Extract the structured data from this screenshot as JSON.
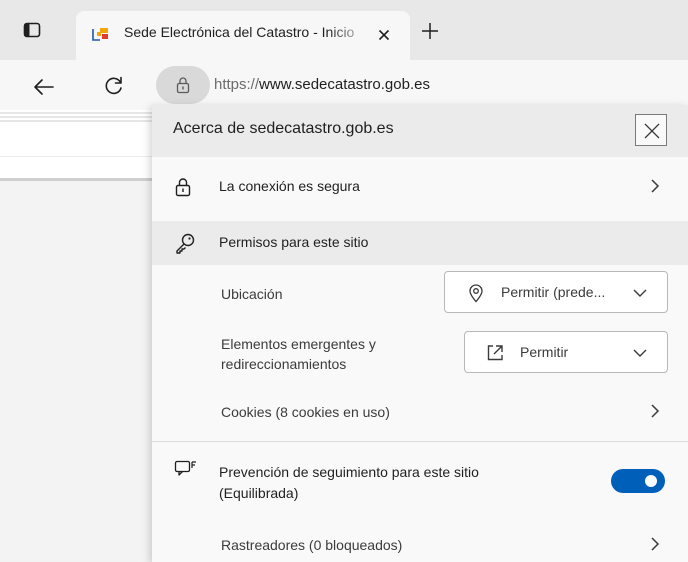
{
  "browser": {
    "tab": {
      "title": "Sede Electrónica del Catastro - Inicio"
    },
    "address": {
      "scheme": "https://",
      "host": "www.sedecatastro.gob.es"
    }
  },
  "flyout": {
    "title": "Acerca de sedecatastro.gob.es",
    "connection": {
      "label": "La conexión es segura"
    },
    "permissions": {
      "header": "Permisos para este sitio",
      "location": {
        "label": "Ubicación",
        "value": "Permitir (prede..."
      },
      "popups": {
        "label": "Elementos emergentes y redireccionamientos",
        "value": "Permitir"
      },
      "cookies": {
        "label": "Cookies (8 cookies en uso)"
      }
    },
    "tracking": {
      "label": "Prevención de seguimiento para este sitio (Equilibrada)",
      "enabled": true
    },
    "trackers": {
      "label": "Rastreadores (0 bloqueados)"
    }
  },
  "icons": {
    "tab_actions": "tab-actions-icon",
    "favicon": "catastro-favicon-icon",
    "close": "close-icon",
    "new_tab": "plus-icon",
    "back": "back-arrow-icon",
    "refresh": "refresh-icon",
    "lock": "lock-icon",
    "key": "key-icon",
    "location": "location-pin-icon",
    "external": "open-external-icon",
    "tracking": "tracking-prevention-icon",
    "chevron_right": "chevron-right-icon",
    "chevron_down": "chevron-down-icon"
  },
  "colors": {
    "toggle_on": "#005fb8",
    "flyout_bg": "#f9f9f9",
    "section_bg": "#ebebeb"
  }
}
